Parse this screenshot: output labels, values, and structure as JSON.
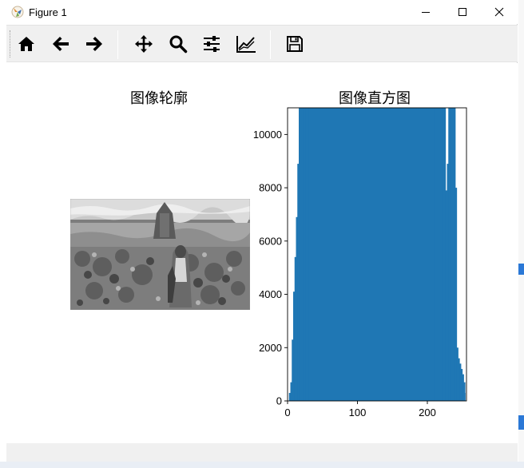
{
  "window": {
    "title": "Figure 1",
    "controls": {
      "minimize": "minimize-icon",
      "maximize": "maximize-icon",
      "close": "close-icon"
    }
  },
  "toolbar": {
    "buttons": [
      {
        "name": "home",
        "icon": "home-icon"
      },
      {
        "name": "back",
        "icon": "arrow-left-icon"
      },
      {
        "name": "forward",
        "icon": "arrow-right-icon"
      },
      {
        "name": "pan",
        "icon": "move-icon"
      },
      {
        "name": "zoom",
        "icon": "magnifier-icon"
      },
      {
        "name": "configure-subplots",
        "icon": "sliders-icon"
      },
      {
        "name": "edit-axes",
        "icon": "line-chart-icon"
      },
      {
        "name": "save",
        "icon": "floppy-disk-icon"
      }
    ]
  },
  "figure": {
    "left_title": "图像轮廓",
    "right_title": "图像直方图"
  },
  "chart_data": {
    "type": "bar",
    "title": "图像直方图",
    "xlabel": "",
    "ylabel": "",
    "xlim": [
      0,
      256
    ],
    "ylim": [
      0,
      11000
    ],
    "xticks": [
      "0",
      "100",
      "200"
    ],
    "yticks": [
      "0",
      "2000",
      "4000",
      "6000",
      "8000",
      "10000"
    ],
    "bar_color": "#1f77b4",
    "bins_x": [
      0,
      2,
      4,
      6,
      8,
      10,
      12,
      14,
      16,
      18,
      20,
      22,
      24,
      26,
      28,
      30,
      40,
      60,
      80,
      100,
      120,
      140,
      160,
      180,
      200,
      210,
      220,
      222,
      224,
      226,
      228,
      230,
      234,
      238,
      240,
      242,
      244,
      246,
      248,
      250,
      252,
      254
    ],
    "counts": [
      0,
      300,
      700,
      2300,
      4100,
      5400,
      6900,
      8900,
      11000,
      11000,
      11000,
      11000,
      11000,
      11000,
      11000,
      11000,
      11000,
      11000,
      11000,
      11000,
      11000,
      11000,
      11000,
      11000,
      11000,
      11000,
      11000,
      11000,
      11000,
      7900,
      8900,
      11000,
      11000,
      11000,
      8000,
      2000,
      1600,
      1400,
      1200,
      1000,
      700,
      300
    ]
  },
  "status": {
    "text": ""
  }
}
